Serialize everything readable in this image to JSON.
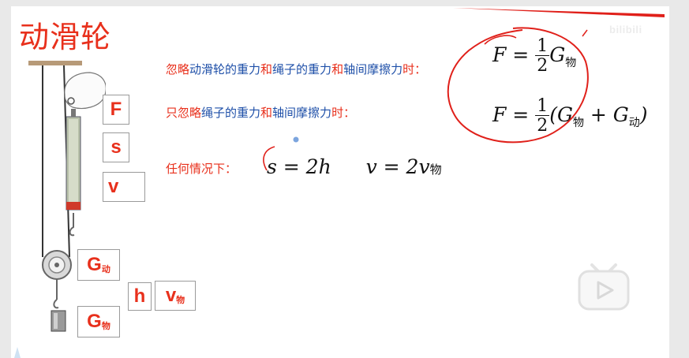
{
  "title": "动滑轮",
  "watermark": "bilibili",
  "conditions": {
    "line1": {
      "parts": [
        "忽略",
        "动滑轮的重力",
        "和",
        "绳子的重力",
        "和",
        "轴间摩擦力",
        "时："
      ]
    },
    "line2": {
      "parts": [
        "只忽略",
        "绳子的重力",
        "和",
        "轴间摩擦力",
        "时："
      ]
    },
    "line3": {
      "text": "任何情况下："
    }
  },
  "formulas": {
    "f1": {
      "lhs": "F =",
      "num": "1",
      "den": "2",
      "var": "G",
      "sub": "物"
    },
    "f2": {
      "lhs": "F =",
      "num": "1",
      "den": "2",
      "open": "(G",
      "sub1": "物",
      "plus": " + G",
      "sub2": "动",
      "close": ")"
    },
    "f3": {
      "s_part": "s = 2h",
      "v_part": "v = 2v",
      "v_sub": "物"
    }
  },
  "labels": {
    "F": "F",
    "s": "s",
    "v": "v",
    "G_dong": "G",
    "G_dong_sub": "动",
    "h": "h",
    "v_wu": "v",
    "v_wu_sub": "物",
    "G_wu": "G",
    "G_wu_sub": "物"
  },
  "colors": {
    "red": "#e8301c",
    "blue": "#1e4fa8",
    "annotation": "#e0201a"
  }
}
